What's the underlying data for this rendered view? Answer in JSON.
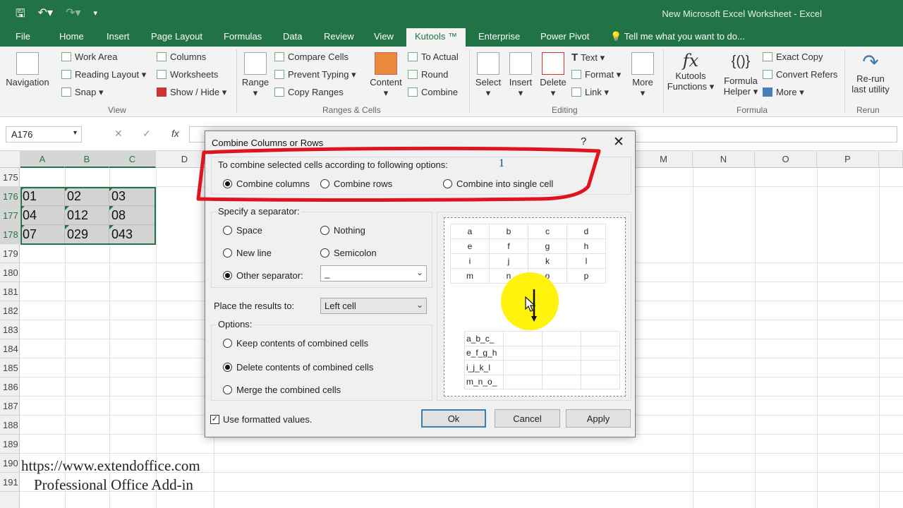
{
  "window_title": "New Microsoft Excel Worksheet - Excel",
  "tabs": [
    "File",
    "Home",
    "Insert",
    "Page Layout",
    "Formulas",
    "Data",
    "Review",
    "View",
    "Kutools ™",
    "Enterprise",
    "Power Pivot",
    "Tell me what you want to do..."
  ],
  "ribbon": {
    "navigation": "Navigation",
    "work_area": "Work Area",
    "reading_layout": "Reading Layout",
    "snap": "Snap",
    "columns": "Columns",
    "worksheets": "Worksheets",
    "show_hide": "Show / Hide",
    "view_group": "View",
    "range": "Range",
    "compare_cells": "Compare Cells",
    "prevent_typing": "Prevent Typing",
    "copy_ranges": "Copy Ranges",
    "content": "Content",
    "to_actual": "To Actual",
    "round": "Round",
    "combine": "Combine",
    "ranges_group": "Ranges & Cells",
    "select": "Select",
    "insert": "Insert",
    "delete": "Delete",
    "text": "Text",
    "format": "Format",
    "link": "Link",
    "more": "More",
    "editing_group": "Editing",
    "kutools_functions_1": "Kutools",
    "kutools_functions_2": "Functions",
    "formula_helper_1": "Formula",
    "formula_helper_2": "Helper",
    "exact_copy": "Exact Copy",
    "convert_refers": "Convert Refers",
    "more2": "More",
    "formula_group": "Formula",
    "rerun_1": "Re-run",
    "rerun_2": "last utility",
    "rerun_group": "Rerun"
  },
  "formula_bar": {
    "name_box": "A176",
    "fx": "fx"
  },
  "columns_left": [
    "A",
    "B",
    "C",
    "D"
  ],
  "columns_right": [
    "M",
    "N",
    "O",
    "P"
  ],
  "rows": [
    "175",
    "176",
    "177",
    "178",
    "179",
    "180",
    "181",
    "182",
    "183",
    "184",
    "185",
    "186",
    "187",
    "188",
    "189",
    "190",
    "191"
  ],
  "cells": [
    [
      "01",
      "02",
      "03"
    ],
    [
      "04",
      "012",
      "08"
    ],
    [
      "07",
      "029",
      "043"
    ]
  ],
  "watermark": {
    "url": "https://www.extendoffice.com",
    "tagline": "Professional Office Add-in"
  },
  "dialog": {
    "title": "Combine Columns or Rows",
    "help": "?",
    "close": "✕",
    "instruction": "To combine selected cells according to following options:",
    "annotation": "1",
    "opt_columns": "Combine columns",
    "opt_rows": "Combine rows",
    "opt_single": "Combine into single cell",
    "separator_label": "Specify a separator:",
    "sep_space": "Space",
    "sep_nothing": "Nothing",
    "sep_newline": "New line",
    "sep_semicolon": "Semicolon",
    "sep_other": "Other separator:",
    "sep_other_value": "_",
    "place_label": "Place the results to:",
    "place_value": "Left cell",
    "options_label": "Options:",
    "opt_keep": "Keep contents of combined cells",
    "opt_delete": "Delete contents of combined cells",
    "opt_merge": "Merge the combined cells",
    "use_formatted": "Use formatted values.",
    "ok": "Ok",
    "cancel": "Cancel",
    "apply": "Apply",
    "preview_grid": [
      [
        "a",
        "b",
        "c",
        "d"
      ],
      [
        "e",
        "f",
        "g",
        "h"
      ],
      [
        "i",
        "j",
        "k",
        "l"
      ],
      [
        "m",
        "n",
        "o",
        "p"
      ]
    ],
    "preview_result": [
      "a_b_c_",
      "e_f_g_h",
      "i_j_k_l",
      "m_n_o_"
    ]
  }
}
